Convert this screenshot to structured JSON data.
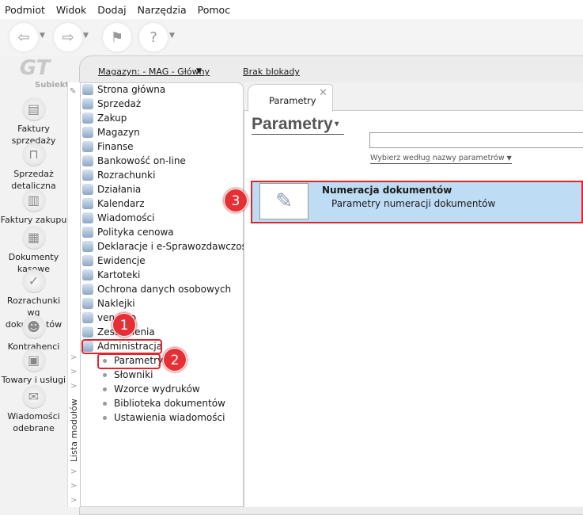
{
  "menu": [
    "Podmiot",
    "Widok",
    "Dodaj",
    "Narzędzia",
    "Pomoc"
  ],
  "logo": {
    "mark": "GT",
    "name": "Subiekt"
  },
  "sidebar": [
    {
      "label": "Faktury sprzedaży",
      "icon": "coins-icon"
    },
    {
      "label": "Sprzedaż detaliczna",
      "icon": "basket-icon"
    },
    {
      "label": "Faktury zakupu",
      "icon": "books-icon"
    },
    {
      "label": "Dokumenty kasowe",
      "icon": "cash-register-icon"
    },
    {
      "label": "Rozrachunki wg dokumentów",
      "icon": "checkmark-docs-icon"
    },
    {
      "label": "Kontrahenci",
      "icon": "person-icon"
    },
    {
      "label": "Towary i usługi",
      "icon": "product-icon"
    },
    {
      "label": "Wiadomości odebrane",
      "icon": "message-icon"
    }
  ],
  "header": {
    "warehouse": "Magazyn: - MAG - Główny",
    "lock": "Brak blokady"
  },
  "strip_label": "Lista modułów",
  "tree": [
    "Strona główna",
    "Sprzedaż",
    "Zakup",
    "Magazyn",
    "Finanse",
    "Bankowość on-line",
    "Rozrachunki",
    "Działania",
    "Kalendarz",
    "Wiadomości",
    "Polityka cenowa",
    "Deklaracje i e-Sprawozdawczość",
    "Ewidencje",
    "Kartoteki",
    "Ochrona danych osobowych",
    "Naklejki",
    "vendero",
    "Zestawienia",
    "Administracja"
  ],
  "subtree": [
    "Parametry",
    "Słowniki",
    "Wzorce wydruków",
    "Biblioteka dokumentów",
    "Ustawienia wiadomości"
  ],
  "badges": [
    "1",
    "2",
    "3"
  ],
  "tab": {
    "label": "Parametry",
    "close": "✕"
  },
  "page": {
    "title": "Parametry",
    "search_value": "",
    "filter": "Wybierz według nazwy parametrów"
  },
  "item": {
    "title": "Numeracja dokumentów",
    "subtitle": "Parametry numeracji dokumentów"
  }
}
